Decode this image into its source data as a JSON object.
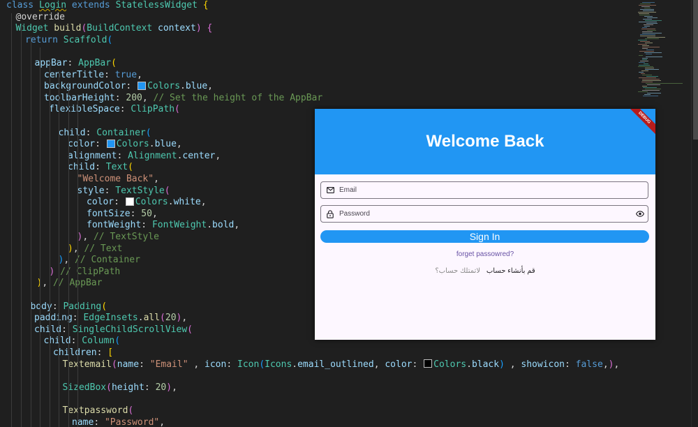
{
  "editor": {
    "lines": [
      {
        "indent": 0,
        "tokens": [
          [
            "kw",
            "class "
          ],
          [
            "cls",
            "Login",
            "squiggle"
          ],
          [
            "kw",
            " extends "
          ],
          [
            "cls",
            "StatelessWidget"
          ],
          [
            "plain",
            " "
          ],
          [
            "p1",
            "{"
          ]
        ]
      },
      {
        "indent": 1,
        "tokens": [
          [
            "ann",
            "@override"
          ]
        ]
      },
      {
        "indent": 1,
        "tokens": [
          [
            "cls",
            "Widget "
          ],
          [
            "fn",
            "build"
          ],
          [
            "p2",
            "("
          ],
          [
            "cls",
            "BuildContext"
          ],
          [
            "prop",
            " context"
          ],
          [
            "p2",
            ")"
          ],
          [
            "plain",
            " "
          ],
          [
            "p2",
            "{"
          ]
        ]
      },
      {
        "indent": 2,
        "tokens": [
          [
            "kw",
            "return "
          ],
          [
            "cls",
            "Scaffold"
          ],
          [
            "p3",
            "("
          ]
        ]
      },
      {
        "indent": 0,
        "tokens": []
      },
      {
        "indent": 3,
        "tokens": [
          [
            "prop",
            "appBar"
          ],
          [
            "plain",
            ": "
          ],
          [
            "cls",
            "AppBar"
          ],
          [
            "p1",
            "("
          ]
        ]
      },
      {
        "indent": 4,
        "tokens": [
          [
            "prop",
            "centerTitle"
          ],
          [
            "plain",
            ": "
          ],
          [
            "kw",
            "true"
          ],
          [
            "plain",
            ","
          ]
        ]
      },
      {
        "indent": 4,
        "tokens": [
          [
            "prop",
            "backgroundColor"
          ],
          [
            "plain",
            ": "
          ],
          [
            "swatch",
            "#2196f3"
          ],
          [
            "cls",
            "Colors"
          ],
          [
            "plain",
            "."
          ],
          [
            "prop",
            "blue"
          ],
          [
            "plain",
            ","
          ]
        ]
      },
      {
        "indent": 4,
        "tokens": [
          [
            "prop",
            "toolbarHeight"
          ],
          [
            "plain",
            ": "
          ],
          [
            "num",
            "200"
          ],
          [
            "plain",
            ", "
          ],
          [
            "cm",
            "// Set the height of the AppBar"
          ]
        ]
      },
      {
        "indent": 4,
        "pad": 7,
        "tokens": [
          [
            "prop",
            "flexibleSpace"
          ],
          [
            "plain",
            ": "
          ],
          [
            "cls",
            "ClipPath"
          ],
          [
            "p2",
            "("
          ]
        ]
      },
      {
        "indent": 0,
        "tokens": []
      },
      {
        "indent": 5,
        "pad": 7,
        "tokens": [
          [
            "prop",
            "child"
          ],
          [
            "plain",
            ": "
          ],
          [
            "cls",
            "Container"
          ],
          [
            "p3",
            "("
          ]
        ]
      },
      {
        "indent": 6,
        "pad": 7,
        "tokens": [
          [
            "prop",
            "color"
          ],
          [
            "plain",
            ": "
          ],
          [
            "swatch",
            "#2196f3"
          ],
          [
            "cls",
            "Colors"
          ],
          [
            "plain",
            "."
          ],
          [
            "prop",
            "blue"
          ],
          [
            "plain",
            ","
          ]
        ]
      },
      {
        "indent": 6,
        "pad": 7,
        "tokens": [
          [
            "prop",
            "alignment"
          ],
          [
            "plain",
            ": "
          ],
          [
            "cls",
            "Alignment"
          ],
          [
            "plain",
            "."
          ],
          [
            "prop",
            "center"
          ],
          [
            "plain",
            ","
          ]
        ]
      },
      {
        "indent": 6,
        "pad": 7,
        "tokens": [
          [
            "prop",
            "child"
          ],
          [
            "plain",
            ": "
          ],
          [
            "cls",
            "Text"
          ],
          [
            "p1",
            "("
          ]
        ]
      },
      {
        "indent": 7,
        "pad": 7,
        "tokens": [
          [
            "str",
            "\"Welcome Back\""
          ],
          [
            "plain",
            ","
          ]
        ]
      },
      {
        "indent": 7,
        "pad": 7,
        "tokens": [
          [
            "prop",
            "style"
          ],
          [
            "plain",
            ": "
          ],
          [
            "cls",
            "TextStyle"
          ],
          [
            "p2",
            "("
          ]
        ]
      },
      {
        "indent": 8,
        "pad": 7,
        "tokens": [
          [
            "prop",
            "color"
          ],
          [
            "plain",
            ": "
          ],
          [
            "swatch",
            "#ffffff"
          ],
          [
            "cls",
            "Colors"
          ],
          [
            "plain",
            "."
          ],
          [
            "prop",
            "white"
          ],
          [
            "plain",
            ","
          ]
        ]
      },
      {
        "indent": 8,
        "pad": 7,
        "tokens": [
          [
            "prop",
            "fontSize"
          ],
          [
            "plain",
            ": "
          ],
          [
            "num",
            "50"
          ],
          [
            "plain",
            ","
          ]
        ]
      },
      {
        "indent": 8,
        "pad": 7,
        "tokens": [
          [
            "prop",
            "fontWeight"
          ],
          [
            "plain",
            ": "
          ],
          [
            "cls",
            "FontWeight"
          ],
          [
            "plain",
            "."
          ],
          [
            "prop",
            "bold"
          ],
          [
            "plain",
            ","
          ]
        ]
      },
      {
        "indent": 7,
        "pad": 7,
        "tokens": [
          [
            "p2",
            ")"
          ],
          [
            "plain",
            ", "
          ],
          [
            "cm",
            "// TextStyle"
          ]
        ]
      },
      {
        "indent": 6,
        "pad": 7,
        "tokens": [
          [
            "p1",
            ")"
          ],
          [
            "plain",
            ", "
          ],
          [
            "cm",
            "// Text"
          ]
        ]
      },
      {
        "indent": 5,
        "pad": 7,
        "tokens": [
          [
            "p3",
            ")"
          ],
          [
            "plain",
            ", "
          ],
          [
            "cm",
            "// Container"
          ]
        ]
      },
      {
        "indent": 5,
        "pad": -6,
        "tokens": [
          [
            "p2",
            ")"
          ],
          [
            "plain",
            " "
          ],
          [
            "cm",
            "// ClipPath"
          ]
        ]
      },
      {
        "indent": 3,
        "pad": 3,
        "tokens": [
          [
            "p1",
            ")"
          ],
          [
            "plain",
            ", "
          ],
          [
            "cm",
            "// AppBar"
          ]
        ]
      },
      {
        "indent": 0,
        "tokens": []
      },
      {
        "indent": 3,
        "pad": -6,
        "tokens": [
          [
            "prop",
            "body"
          ],
          [
            "plain",
            ": "
          ],
          [
            "cls",
            "Padding"
          ],
          [
            "p1",
            "("
          ]
        ]
      },
      {
        "indent": 4,
        "pad": -14,
        "tokens": [
          [
            "prop",
            "padding"
          ],
          [
            "plain",
            ": "
          ],
          [
            "cls",
            "EdgeInsets"
          ],
          [
            "plain",
            "."
          ],
          [
            "fn",
            "all"
          ],
          [
            "p2",
            "("
          ],
          [
            "num",
            "20"
          ],
          [
            "p2",
            ")"
          ],
          [
            "plain",
            ","
          ]
        ]
      },
      {
        "indent": 4,
        "pad": -14,
        "tokens": [
          [
            "prop",
            "child"
          ],
          [
            "plain",
            ": "
          ],
          [
            "cls",
            "SingleChildScrollView"
          ],
          [
            "p2",
            "("
          ]
        ]
      },
      {
        "indent": 5,
        "pad": -14,
        "tokens": [
          [
            "prop",
            "child"
          ],
          [
            "plain",
            ": "
          ],
          [
            "cls",
            "Column"
          ],
          [
            "p3",
            "("
          ]
        ]
      },
      {
        "indent": 6,
        "pad": -14,
        "tokens": [
          [
            "prop",
            "children"
          ],
          [
            "plain",
            ": "
          ],
          [
            "p1",
            "["
          ]
        ]
      },
      {
        "indent": 7,
        "pad": -14,
        "tokens": [
          [
            "fn",
            "Textemail"
          ],
          [
            "p2",
            "("
          ],
          [
            "prop",
            "name"
          ],
          [
            "plain",
            ": "
          ],
          [
            "str",
            "\"Email\""
          ],
          [
            "plain",
            " , "
          ],
          [
            "prop",
            "icon"
          ],
          [
            "plain",
            ": "
          ],
          [
            "cls",
            "Icon"
          ],
          [
            "p3",
            "("
          ],
          [
            "cls",
            "Icons"
          ],
          [
            "plain",
            "."
          ],
          [
            "prop",
            "email_outlined"
          ],
          [
            "plain",
            ", "
          ],
          [
            "prop",
            "color"
          ],
          [
            "plain",
            ": "
          ],
          [
            "swatch",
            "#000000"
          ],
          [
            "cls",
            "Colors"
          ],
          [
            "plain",
            "."
          ],
          [
            "prop",
            "black"
          ],
          [
            "p3",
            ")"
          ],
          [
            "plain",
            " , "
          ],
          [
            "prop",
            "showicon"
          ],
          [
            "plain",
            ": "
          ],
          [
            "kw",
            "false"
          ],
          [
            "plain",
            ","
          ],
          [
            "p2",
            ")"
          ],
          [
            "plain",
            ","
          ]
        ]
      },
      {
        "indent": 0,
        "tokens": []
      },
      {
        "indent": 7,
        "pad": -14,
        "tokens": [
          [
            "cls",
            "SizedBox"
          ],
          [
            "p2",
            "("
          ],
          [
            "prop",
            "height"
          ],
          [
            "plain",
            ": "
          ],
          [
            "num",
            "20"
          ],
          [
            "p2",
            ")"
          ],
          [
            "plain",
            ","
          ]
        ]
      },
      {
        "indent": 0,
        "tokens": []
      },
      {
        "indent": 7,
        "pad": -14,
        "tokens": [
          [
            "fn",
            "Textpassword"
          ],
          [
            "p2",
            "("
          ]
        ]
      },
      {
        "indent": 8,
        "pad": -14,
        "tokens": [
          [
            "prop",
            "name"
          ],
          [
            "plain",
            ": "
          ],
          [
            "str",
            "\"Password\""
          ],
          [
            "plain",
            ","
          ]
        ]
      }
    ]
  },
  "app": {
    "title": "Welcome Back",
    "debug_banner": "DEBUG",
    "email": {
      "placeholder": "Email",
      "icon": "email-outline-icon"
    },
    "password": {
      "placeholder": "Password",
      "icon": "lock-icon",
      "toggle_icon": "eye-icon"
    },
    "signin_label": "Sign In",
    "forgot_label": "forget passowred?",
    "register_question": "لاتمتلك حساب؟",
    "register_action": "قم بأنشاء حساب",
    "colors": {
      "primary": "#2196f3",
      "surface": "#fdf7ff",
      "link": "#6750a4"
    }
  }
}
